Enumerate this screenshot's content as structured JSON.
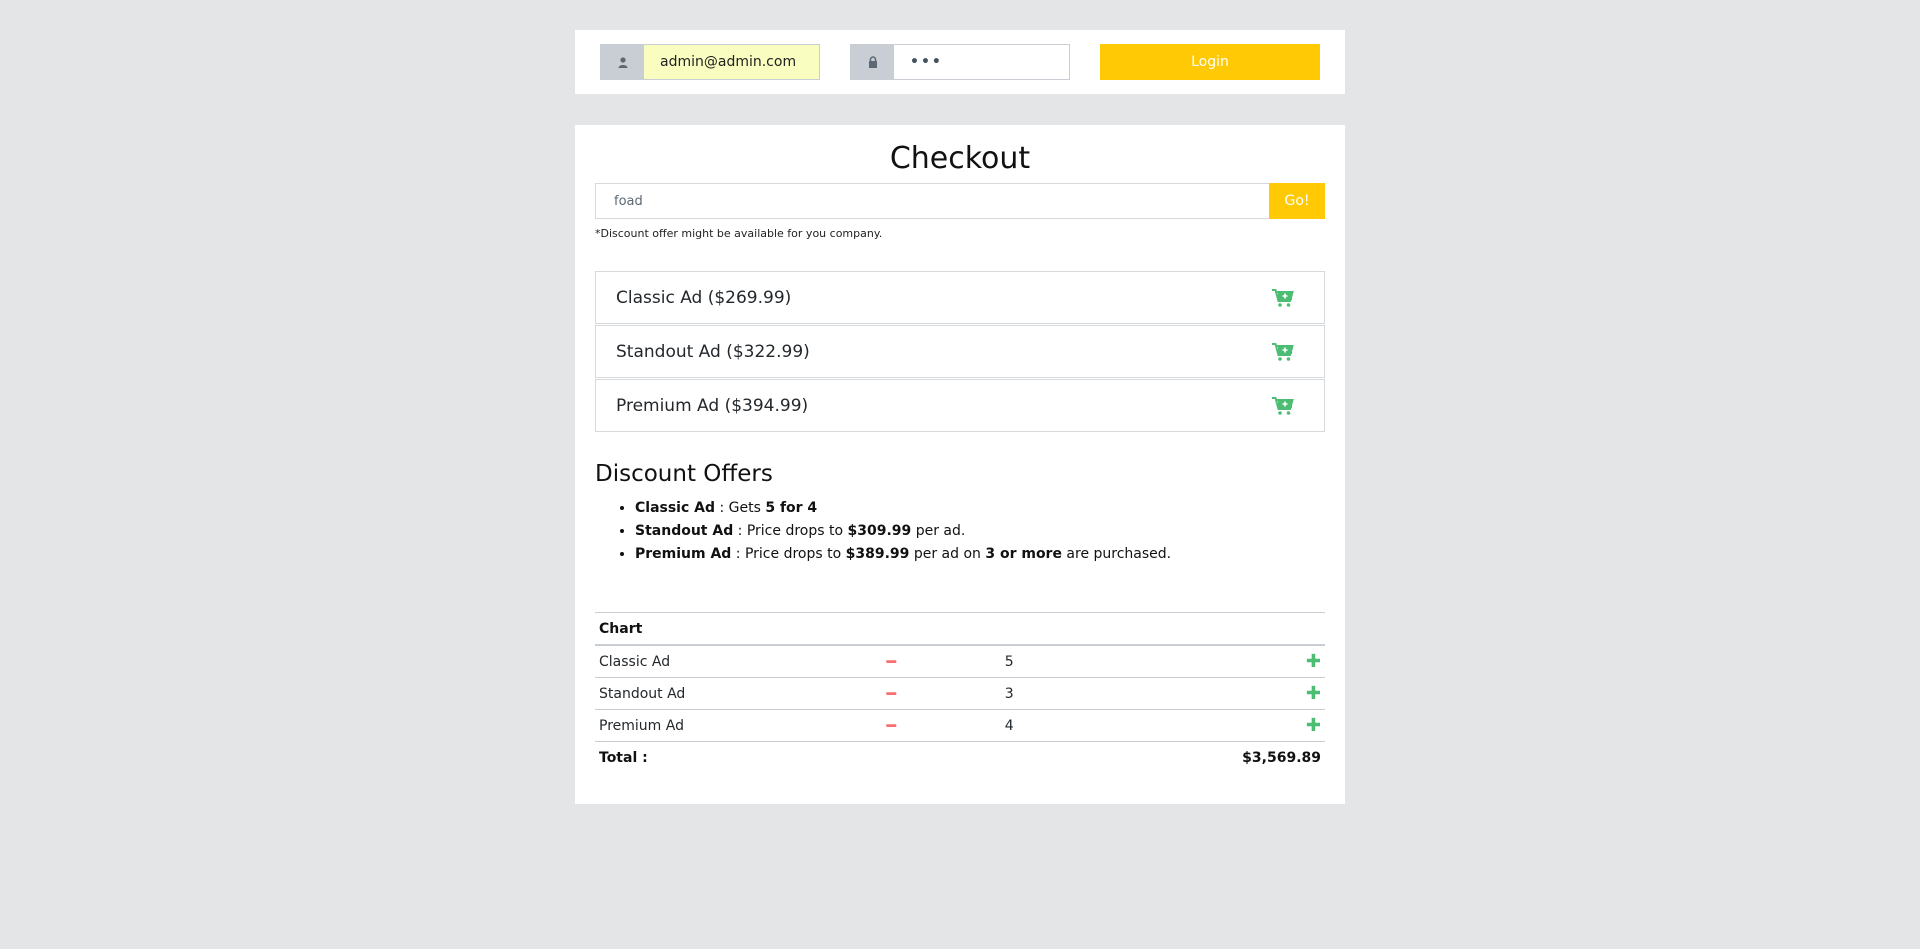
{
  "login": {
    "email_value": "admin@admin.com",
    "password_value": "•••",
    "button_label": "Login"
  },
  "checkout": {
    "title": "Checkout",
    "search_value": "foad",
    "go_label": "Go!",
    "discount_note": "*Discount offer might be available for you company.",
    "products": [
      {
        "label": "Classic Ad ($269.99)"
      },
      {
        "label": "Standout Ad ($322.99)"
      },
      {
        "label": "Premium Ad ($394.99)"
      }
    ]
  },
  "offers": {
    "title": "Discount Offers",
    "items": [
      {
        "name": "Classic Ad",
        "p1": " : Gets ",
        "b1": "5 for 4",
        "p2": "",
        "b2": "",
        "p3": ""
      },
      {
        "name": "Standout Ad",
        "p1": " : Price drops to ",
        "b1": "$309.99",
        "p2": " per ad.",
        "b2": "",
        "p3": ""
      },
      {
        "name": "Premium Ad",
        "p1": " : Price drops to ",
        "b1": "$389.99",
        "p2": " per ad on ",
        "b2": "3 or more",
        "p3": " are purchased."
      }
    ]
  },
  "chart": {
    "header": "Chart",
    "rows": [
      {
        "name": "Classic Ad",
        "qty": "5"
      },
      {
        "name": "Standout Ad",
        "qty": "3"
      },
      {
        "name": "Premium Ad",
        "qty": "4"
      }
    ],
    "total_label": "Total :",
    "total_value": "$3,569.89"
  },
  "colors": {
    "accent": "#ffc905",
    "cart_icon": "#4dbd74",
    "minus": "#f86c6b",
    "plus": "#4dbd74",
    "background": "#e4e5e6"
  },
  "icons": {
    "user": "user-icon",
    "lock": "lock-icon",
    "cart": "cart-plus-icon",
    "minus": "minus-icon",
    "plus": "plus-icon"
  }
}
